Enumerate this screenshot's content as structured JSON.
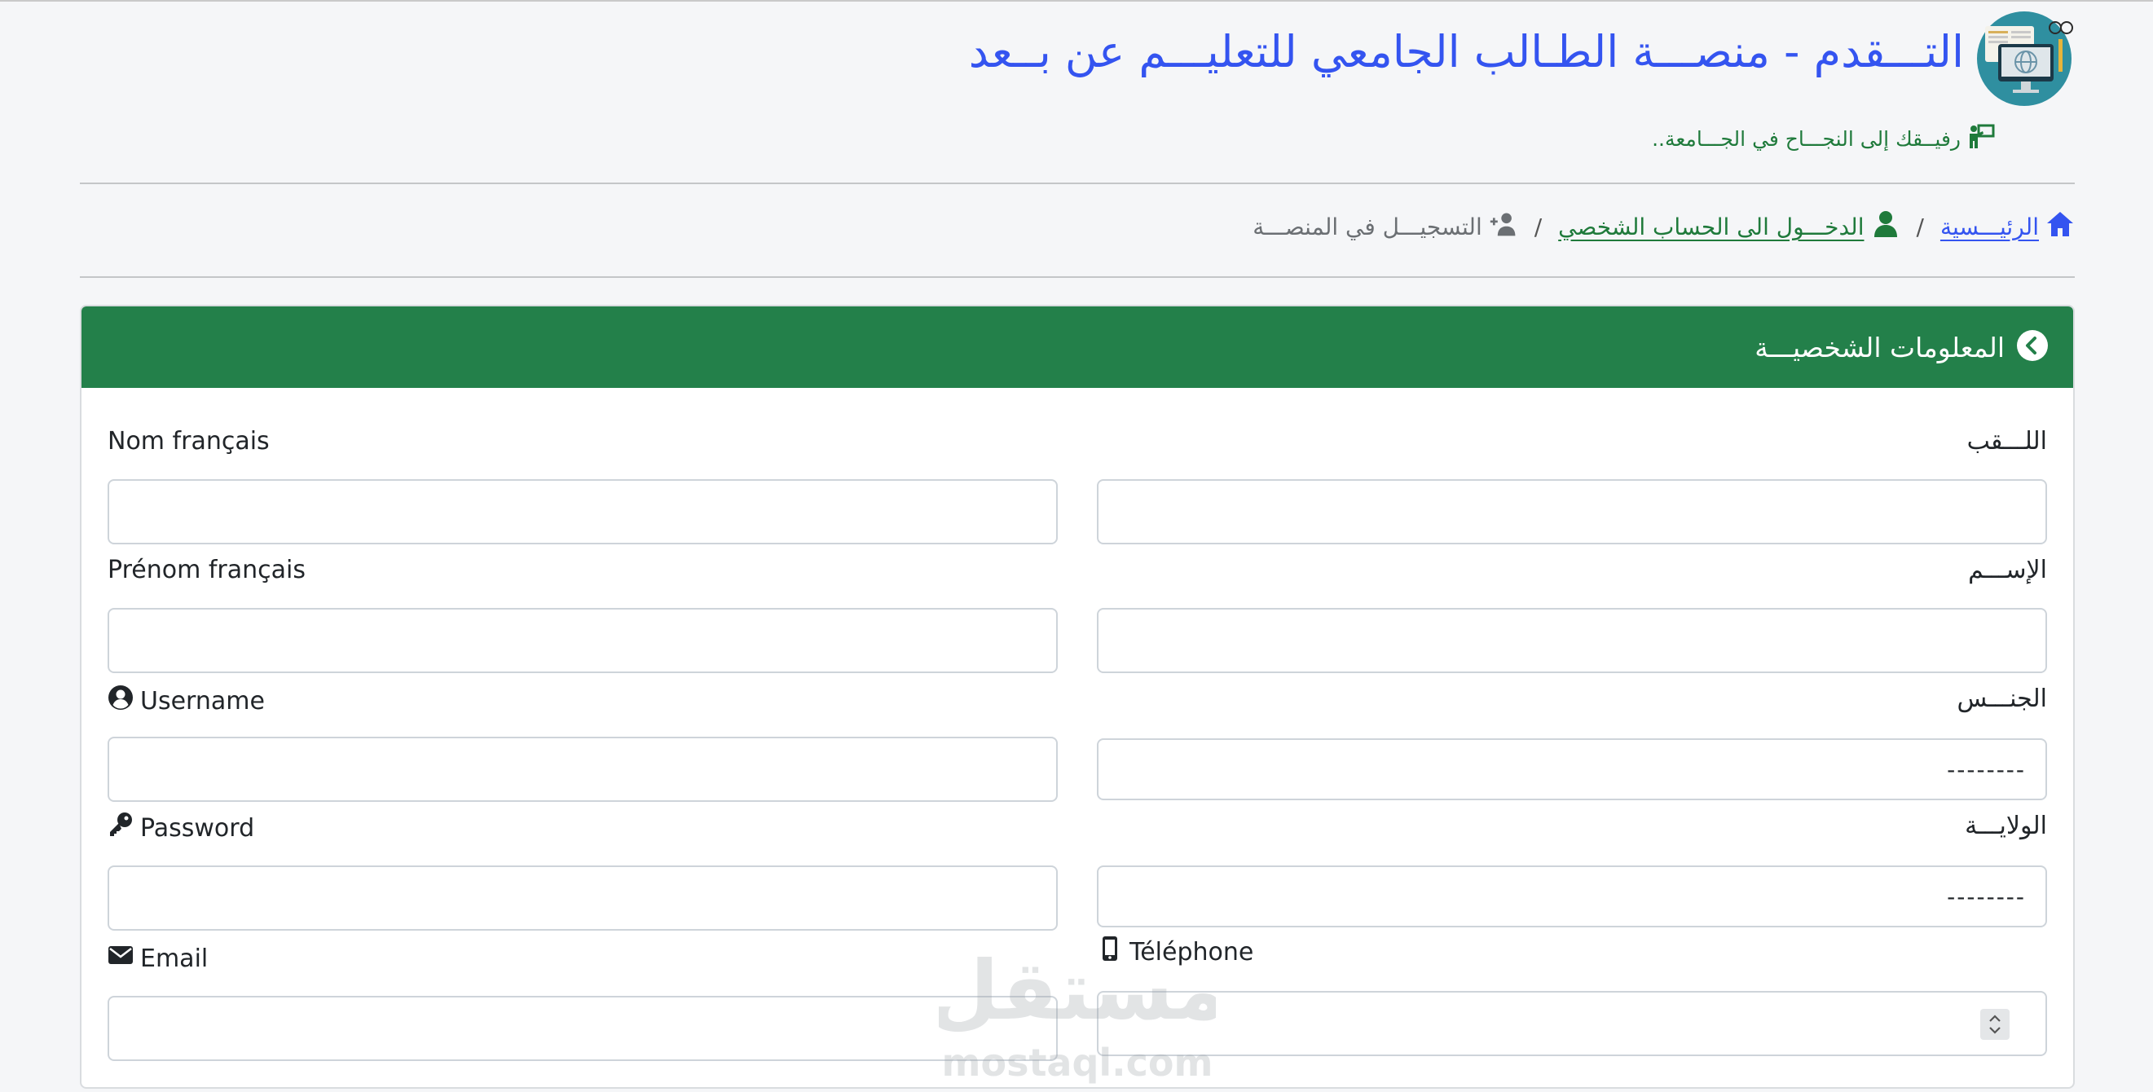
{
  "header": {
    "title": "التـــقدم - منصـــة الطـالب الجامعي للتعليـــم عن بــعد",
    "tagline": "رفيــقك إلى النجـــاح في الجـــامعة.."
  },
  "breadcrumb": {
    "home": "الرئيـــسية",
    "login": "الدخـــول الى الحساب الشخصي",
    "current": "التسجيـــل في المنصـــة",
    "separator": "/"
  },
  "card": {
    "title": "المعلومات الشخصيـــة"
  },
  "form": {
    "nom_francais_label": "Nom français",
    "laqab_label": "اللـــقب",
    "prenom_francais_label": "Prénom français",
    "ism_label": "الإســـم",
    "username_label": "Username",
    "jins_label": "الجنـــس",
    "jins_selected": "--------",
    "password_label": "Password",
    "wilaya_label": "الولايـــة",
    "wilaya_selected": "--------",
    "email_label": "Email",
    "telephone_label": "Téléphone"
  },
  "watermark": {
    "brand": "مستقل",
    "domain": "mostaql.com"
  },
  "colors": {
    "primary_blue": "#3454f0",
    "success_green": "#23804a",
    "tagline_green": "#1f7a3b"
  },
  "icons": {
    "logo": "computer-globe-logo",
    "tagline": "person-board-icon",
    "home": "home-icon",
    "login": "user-icon",
    "register": "user-plus-icon",
    "card": "chevron-circle-icon",
    "username": "user-circle-icon",
    "password": "key-icon",
    "email": "envelope-icon",
    "telephone": "mobile-icon"
  }
}
